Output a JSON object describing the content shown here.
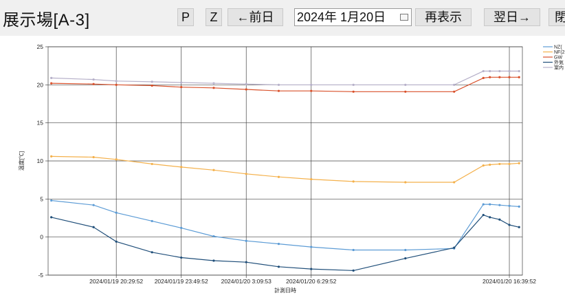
{
  "header": {
    "title": "展示場[A-3]",
    "buttons": {
      "p": "P",
      "z": "Z",
      "prev": "←前日",
      "refresh": "再表示",
      "next": "翌日→",
      "close": "閉"
    },
    "date": "2024年  1月20日"
  },
  "chart_data": {
    "type": "line",
    "xlabel": "計測日時",
    "ylabel": "温度[℃]",
    "ylim": [
      -5,
      25
    ],
    "yticks": [
      -5,
      0,
      5,
      10,
      15,
      20,
      25
    ],
    "grid": true,
    "legend_position": "top-right",
    "xlim": [
      "2024/01/19 17:00:00",
      "2024/01/20 17:20:00"
    ],
    "xticks": [
      "2024/01/19 20:29:52",
      "2024/01/19 23:49:52",
      "2024/01/20 3:09:53",
      "2024/01/20 6:29:52",
      "2024/01/20 16:39:52"
    ],
    "x": [
      "2024/01/19 17:09:52",
      "2024/01/19 19:19:52",
      "2024/01/19 20:29:52",
      "2024/01/19 22:19:52",
      "2024/01/19 23:49:52",
      "2024/01/20 1:29:52",
      "2024/01/20 3:09:53",
      "2024/01/20 4:49:52",
      "2024/01/20 6:29:52",
      "2024/01/20 8:39:52",
      "2024/01/20 11:19:52",
      "2024/01/20 13:49:52",
      "2024/01/20 15:19:52",
      "2024/01/20 15:39:52",
      "2024/01/20 16:09:52",
      "2024/01/20 16:39:52",
      "2024/01/20 17:09:52"
    ],
    "series": [
      {
        "name": "NZ(",
        "color": "#5b9bd5",
        "values": [
          4.8,
          4.2,
          3.2,
          2.1,
          1.2,
          0.1,
          -0.5,
          -0.9,
          -1.3,
          -1.7,
          -1.7,
          -1.5,
          4.3,
          4.3,
          4.2,
          4.1,
          4.0
        ]
      },
      {
        "name": "NF(2",
        "color": "#f4b04a",
        "values": [
          10.6,
          10.5,
          10.2,
          9.6,
          9.2,
          8.8,
          8.3,
          7.9,
          7.6,
          7.3,
          7.2,
          7.2,
          9.4,
          9.5,
          9.6,
          9.6,
          9.7
        ]
      },
      {
        "name": "GW",
        "color": "#d9502a",
        "values": [
          20.2,
          20.1,
          20.0,
          19.9,
          19.7,
          19.6,
          19.4,
          19.2,
          19.2,
          19.1,
          19.1,
          19.1,
          20.9,
          21.0,
          21.0,
          21.0,
          21.0
        ]
      },
      {
        "name": "外気",
        "color": "#1f4e79",
        "values": [
          2.6,
          1.3,
          -0.6,
          -2.0,
          -2.7,
          -3.1,
          -3.3,
          -3.9,
          -4.2,
          -4.4,
          -2.8,
          -1.4,
          2.9,
          2.6,
          2.3,
          1.6,
          1.3
        ]
      },
      {
        "name": "室内",
        "color": "#b6b0c9",
        "values": [
          20.9,
          20.7,
          20.5,
          20.4,
          20.3,
          20.2,
          20.1,
          20.0,
          20.0,
          20.0,
          20.0,
          20.0,
          21.8,
          21.8,
          21.8,
          21.8,
          21.8
        ]
      }
    ]
  }
}
